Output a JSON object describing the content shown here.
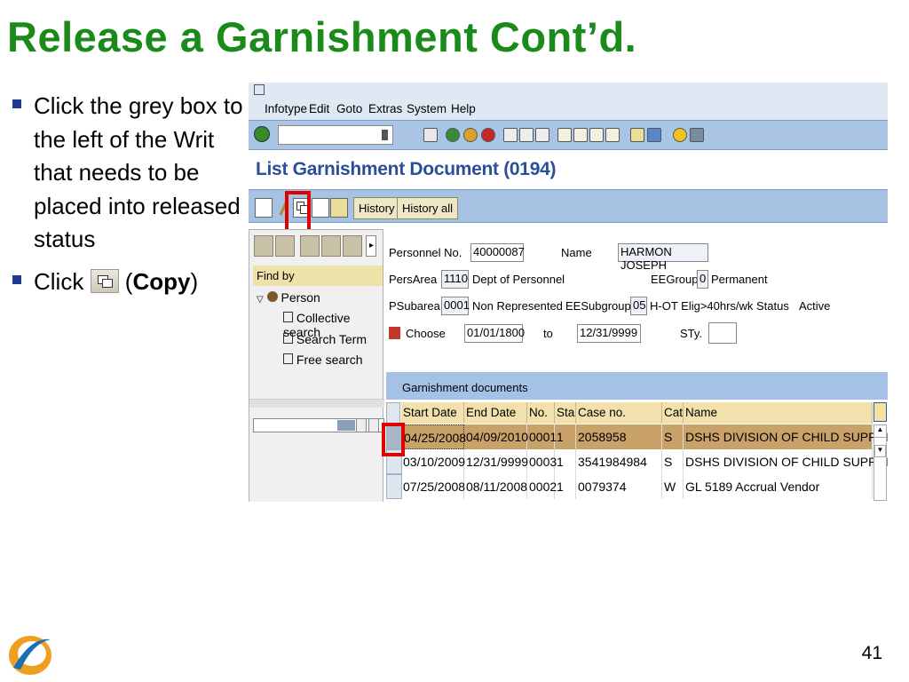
{
  "slide": {
    "title": "Release a Garnishment Cont’d.",
    "page_number": "41"
  },
  "bullets": {
    "first": "Click the grey box to the left of the Writ that needs to be placed into released status",
    "second_pre": "Click",
    "second_paren_open": " (",
    "second_bold": "Copy",
    "second_paren_close": ")"
  },
  "sap": {
    "menu": [
      "Infotype",
      "Edit",
      "Goto",
      "Extras",
      "System",
      "Help"
    ],
    "screen_title": "List Garnishment Document (0194)",
    "toolbar_buttons": [
      "History",
      "History all"
    ],
    "left": {
      "find_by": "Find by",
      "tree_root": "Person",
      "tree_items": [
        "Collective search",
        "Search Term",
        "Free search"
      ]
    },
    "header": {
      "personnel_label": "Personnel No.",
      "personnel_value": "40000087",
      "name_label": "Name",
      "name_value": "HARMON JOSEPH",
      "persarea_label": "PersArea",
      "persarea_value": "1110",
      "persarea_text": "Dept of Personnel",
      "eegroup_label": "EEGroup",
      "eegroup_value": "0",
      "eegroup_text": "Permanent",
      "psubarea_label": "PSubarea",
      "psubarea_value": "0001",
      "psubarea_text": "Non Represented",
      "eesub_label": "EESubgroup",
      "eesub_value": "05",
      "eesub_text": "H-OT Elig>40hrs/wk",
      "status_label": "Status",
      "status_value": "Active",
      "choose_label": "Choose",
      "from_date": "01/01/1800",
      "to_label": "to",
      "to_date": "12/31/9999",
      "sty_label": "STy.",
      "sty_value": ""
    },
    "grid": {
      "title": "Garnishment documents",
      "columns": [
        "Start Date",
        "End Date",
        "No.",
        "Sta",
        "Case no.",
        "Cat",
        "Name"
      ],
      "rows": [
        [
          "04/25/2008",
          "04/09/2010",
          "0001",
          "1",
          "2058958",
          "S",
          "DSHS DIVISION OF CHILD SUPPORT"
        ],
        [
          "03/10/2009",
          "12/31/9999",
          "0003",
          "1",
          "3541984984",
          "S",
          "DSHS DIVISION OF CHILD SUPPORT"
        ],
        [
          "07/25/2008",
          "08/11/2008",
          "0002",
          "1",
          "0079374",
          "W",
          "GL 5189 Accrual Vendor"
        ]
      ]
    }
  }
}
